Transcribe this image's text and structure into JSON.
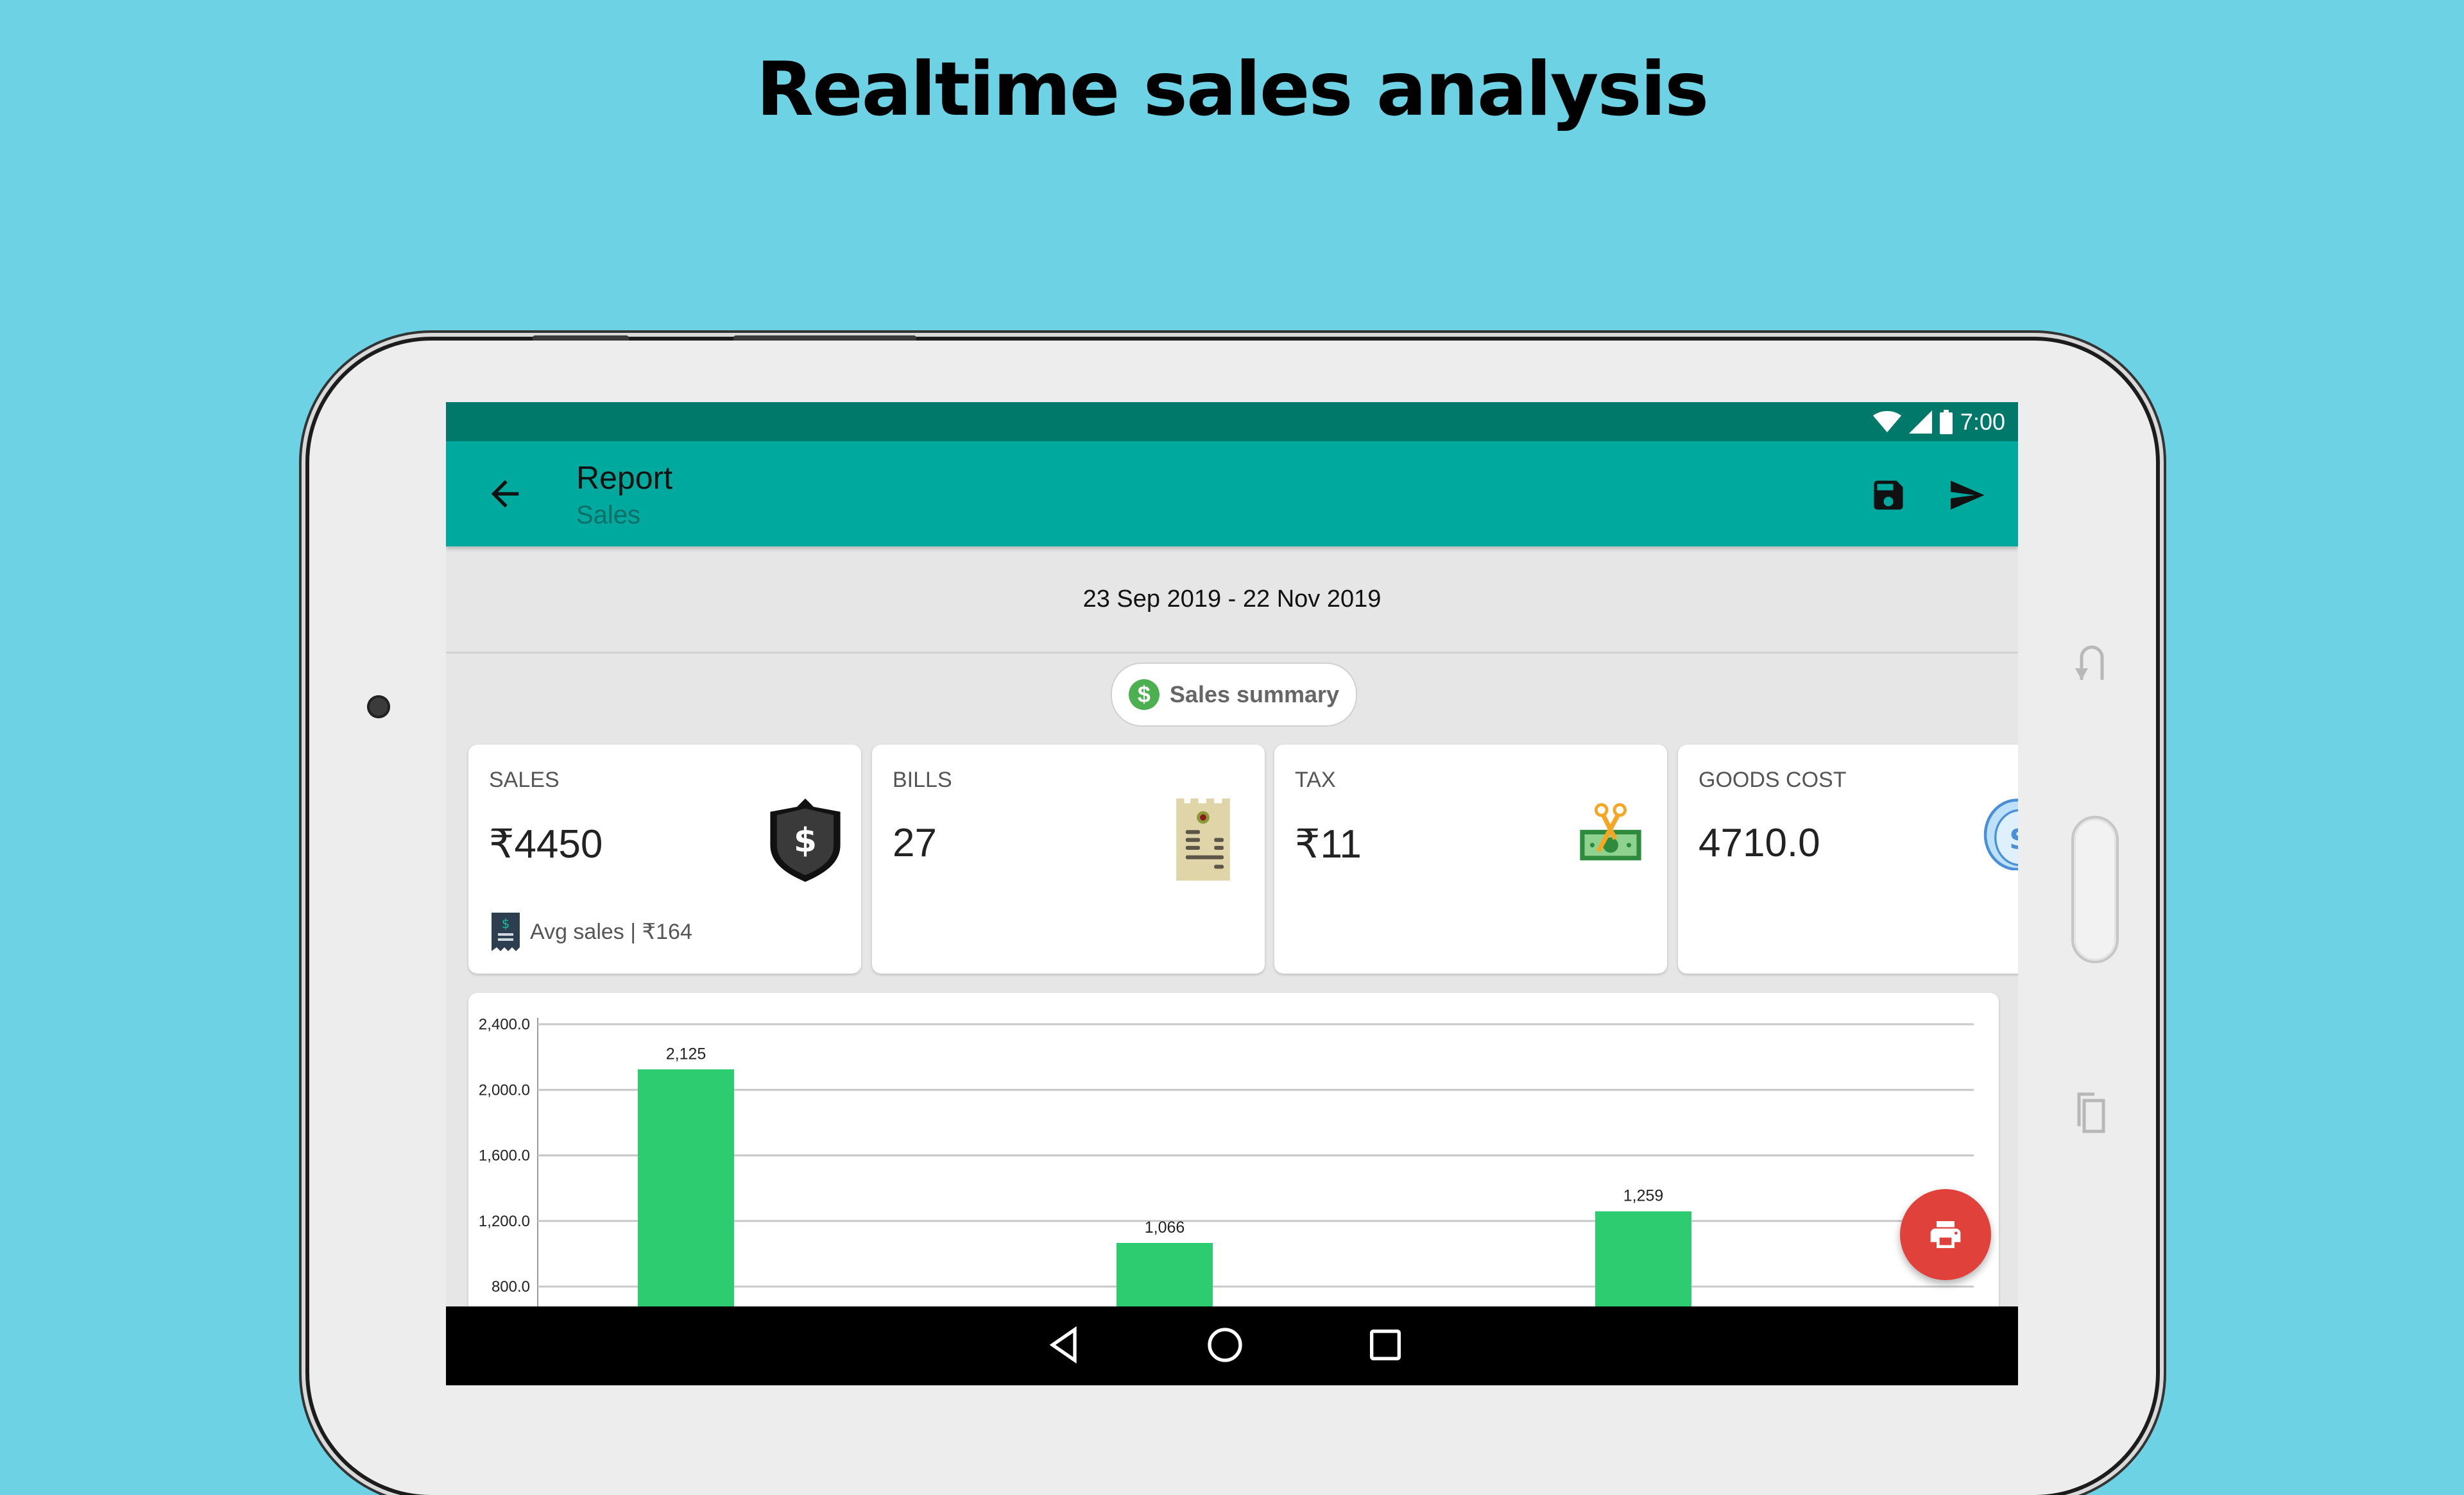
{
  "slide": {
    "title": "Realtime sales analysis"
  },
  "status_bar": {
    "time": "7:00",
    "icons": [
      "wifi-icon",
      "signal-icon",
      "battery-icon"
    ]
  },
  "app_bar": {
    "title": "Report",
    "subtitle": "Sales",
    "back_icon": "arrow-back-icon",
    "actions": [
      {
        "name": "save",
        "icon": "save-icon"
      },
      {
        "name": "send",
        "icon": "send-icon"
      }
    ]
  },
  "date_range": "23 Sep 2019 - 22 Nov 2019",
  "chip": {
    "label": "Sales summary",
    "icon": "dollar-circle-icon",
    "icon_color": "#4caf50"
  },
  "cards": [
    {
      "label": "SALES",
      "value": "₹4450",
      "icon": "shield-dollar-icon",
      "footer": "Avg sales | ₹164",
      "footer_icon": "receipt-dollar-icon"
    },
    {
      "label": "BILLS",
      "value": "27",
      "icon": "receipt-icon"
    },
    {
      "label": "TAX",
      "value": "₹11",
      "icon": "scissors-cash-icon"
    },
    {
      "label": "GOODS COST",
      "value": "4710.0",
      "icon": "coins-dollar-icon"
    }
  ],
  "chart_data": {
    "type": "bar",
    "title": "",
    "xlabel": "",
    "ylabel": "",
    "ylim": [
      800,
      2400
    ],
    "yticks": [
      800,
      1200,
      1600,
      2000,
      2400
    ],
    "ytick_labels": [
      "800.0",
      "1,200.0",
      "1,600.0",
      "2,000.0",
      "2,400.0"
    ],
    "grid": true,
    "bar_color": "#2ecc71",
    "categories": [
      "",
      "",
      ""
    ],
    "values": [
      2125,
      1066,
      1259
    ],
    "value_labels": [
      "2,125",
      "1,066",
      "1,259"
    ]
  },
  "fab": {
    "icon": "print-icon",
    "color": "#e0413a"
  },
  "nav_bar": {
    "buttons": [
      "back",
      "home",
      "recents"
    ]
  },
  "colors": {
    "status_bar": "#00796b",
    "app_bar": "#00a99d",
    "background": "#6cd2e4"
  }
}
